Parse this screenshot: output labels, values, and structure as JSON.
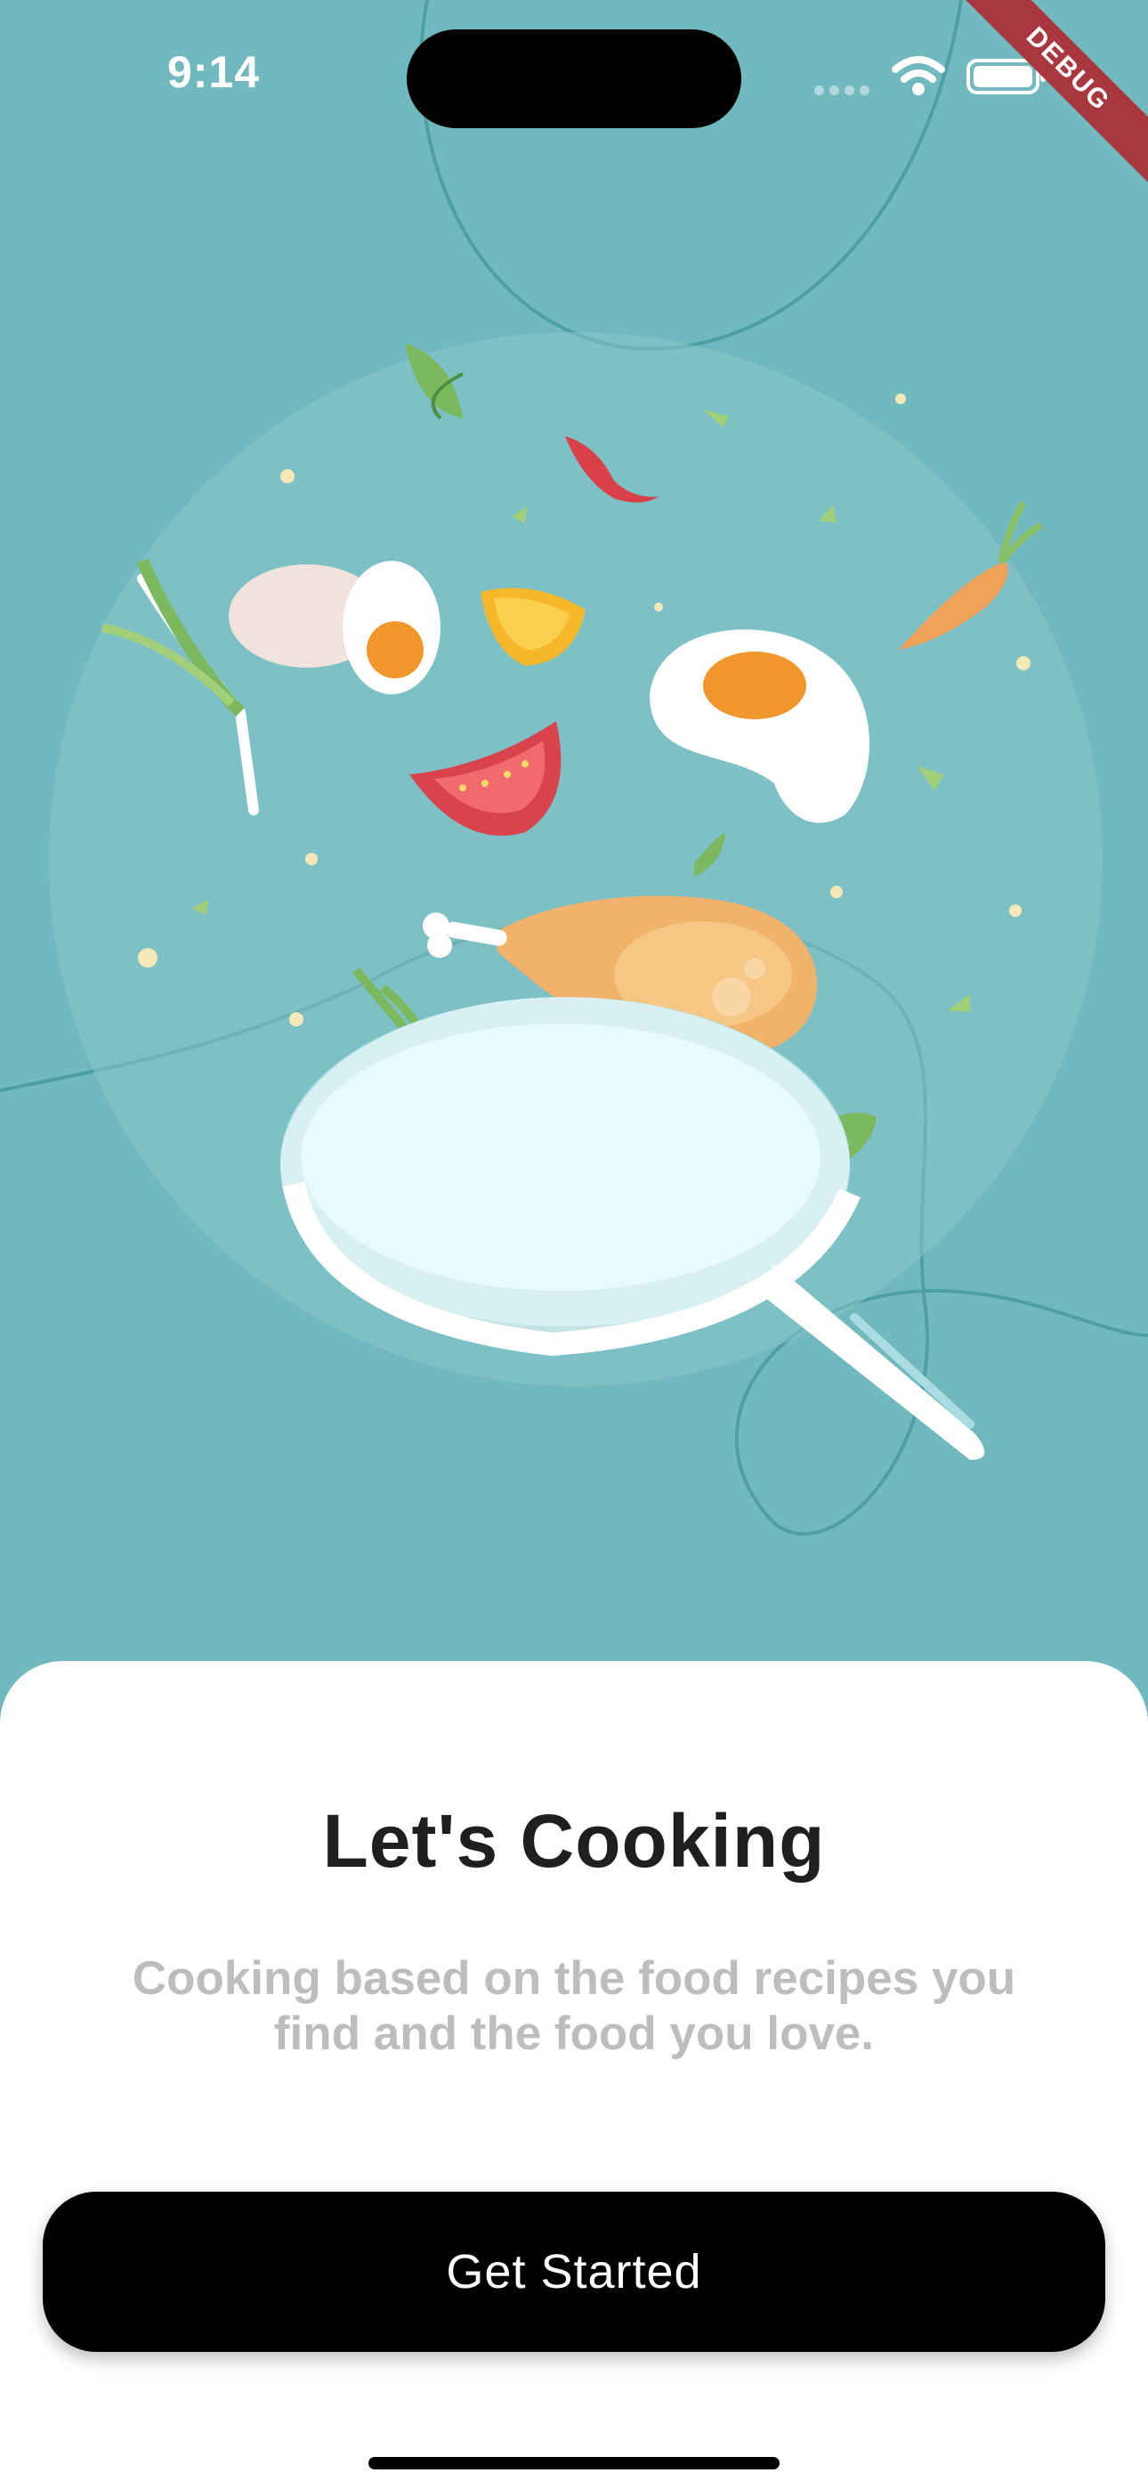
{
  "status_bar": {
    "time": "9:14",
    "debug_label": "DEBUG"
  },
  "onboarding": {
    "title": "Let's Cooking",
    "subtitle_line1": "Cooking based on the food recipes you",
    "subtitle_line2": "find and the food you love.",
    "cta_label": "Get Started"
  },
  "colors": {
    "background": "#72b9bf",
    "sheet": "#ffffff",
    "title": "#1f1f1f",
    "subtitle": "#bdbdbd",
    "button": "#000000",
    "debug_ribbon": "#a8373f"
  },
  "illustration": {
    "icon": "cooking-pan-ingredients-illustration"
  }
}
